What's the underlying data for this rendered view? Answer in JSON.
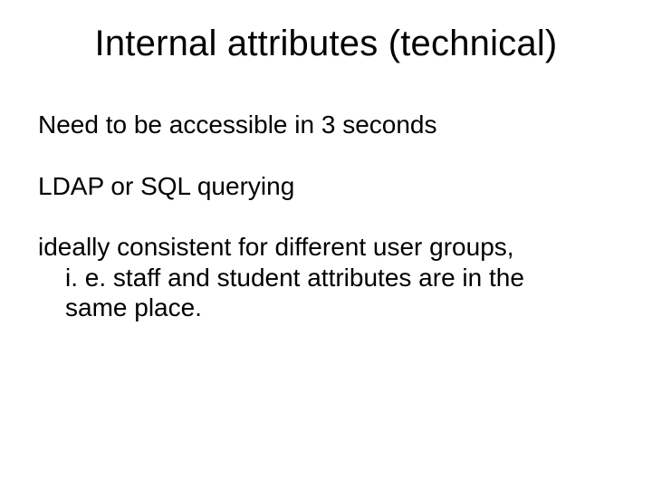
{
  "slide": {
    "title": "Internal attributes (technical)",
    "p1": "Need to be accessible in 3 seconds",
    "p2": "LDAP or SQL querying",
    "p3_l1": "ideally consistent for different user groups,",
    "p3_l2": "i. e. staff and student attributes are in the",
    "p3_l3": "same place."
  }
}
